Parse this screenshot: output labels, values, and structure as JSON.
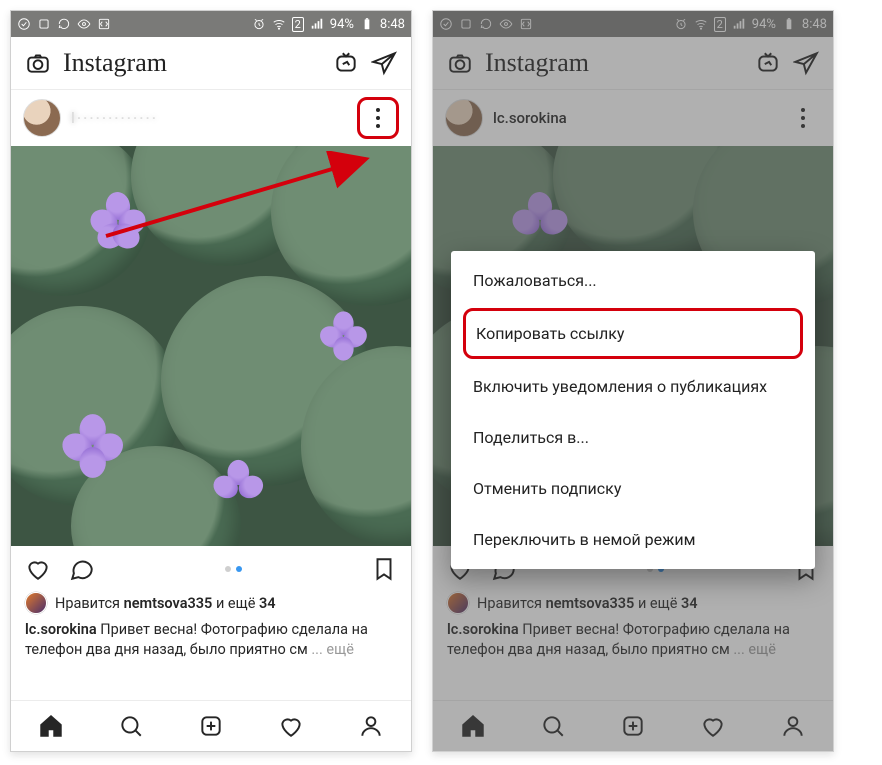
{
  "statusbar": {
    "battery_pct": "94%",
    "time": "8:48",
    "sim_label": "2"
  },
  "app": {
    "title": "Instagram"
  },
  "post": {
    "username_left_hidden": "l·············",
    "username": "lc.sorokina",
    "likes_prefix": "Нравится",
    "likes_user": "nemtsova335",
    "likes_rest": "и ещё",
    "likes_count": "34",
    "caption_user": "lc.sorokina",
    "caption_text": "Привет весна! Фотографию сделала на телефон два дня назад, было приятно см",
    "caption_more": "ещё"
  },
  "menu": {
    "items": [
      "Пожаловаться...",
      "Копировать ссылку",
      "Включить уведомления о публикациях",
      "Поделиться в...",
      "Отменить подписку",
      "Переключить в немой режим"
    ]
  },
  "colors": {
    "annotation": "#d4000c",
    "ig_blue": "#3897f0"
  }
}
